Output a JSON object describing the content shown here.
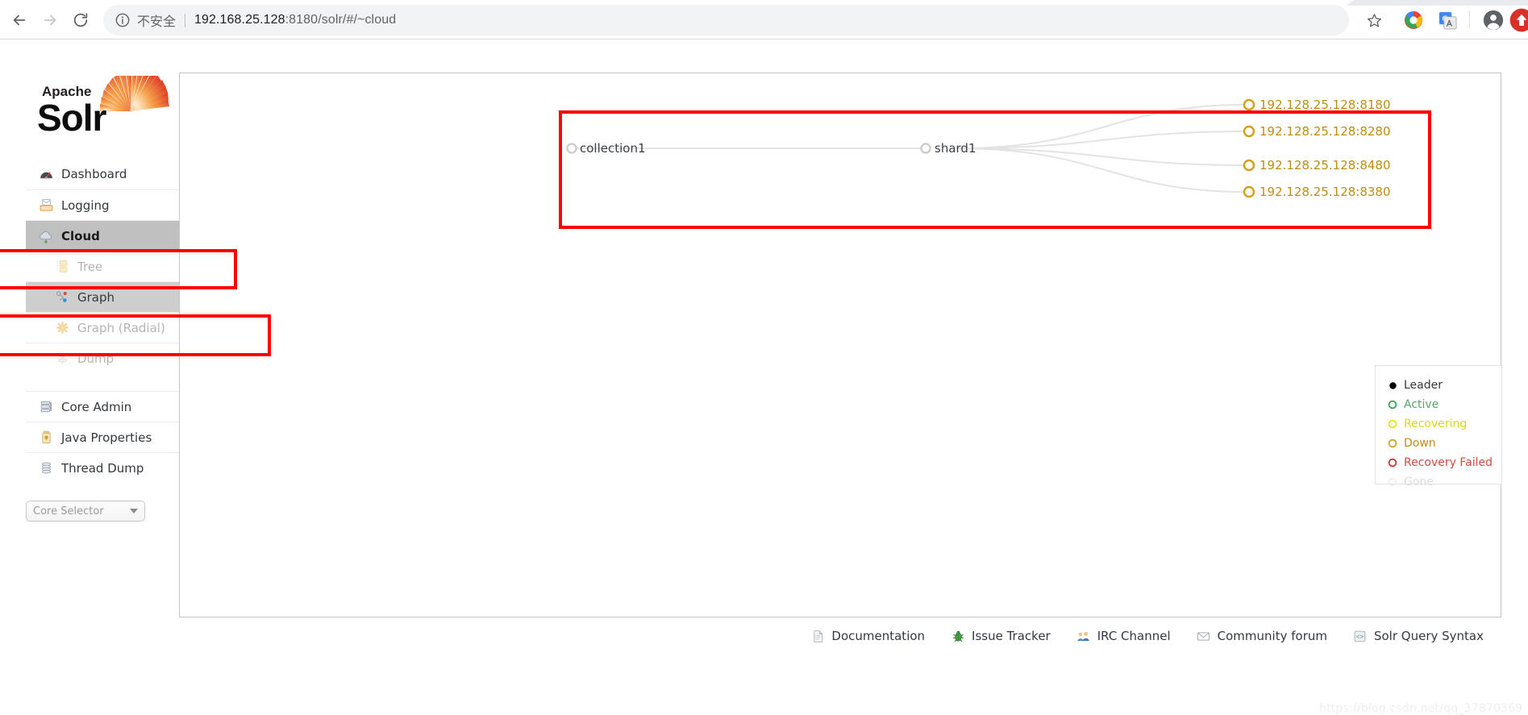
{
  "browser": {
    "back_icon": "arrow-left-icon",
    "forward_icon": "arrow-right-icon",
    "reload_icon": "reload-icon",
    "info_icon": "info-circle-icon",
    "security_label": "不安全",
    "url_prefix": "192.168.25.128",
    "url_port": ":8180",
    "url_path": "/solr/#/~cloud",
    "url_full": "192.168.25.128:8180/solr/#/~cloud",
    "star_icon": "bookmark-star-icon",
    "chrome_ring_icon": "chrome-extension-icon",
    "translate_icon": "google-translate-icon",
    "profile_icon": "profile-avatar-icon",
    "update_icon": "update-available-icon"
  },
  "sidebar": {
    "logo_alt": "Apache Solr",
    "logo_word_top": "Apache",
    "logo_word_main": "Solr",
    "items": [
      {
        "label": "Dashboard",
        "icon": "dashboard-gauge-icon",
        "state": "normal",
        "sub": false
      },
      {
        "label": "Logging",
        "icon": "logging-tray-icon",
        "state": "normal",
        "sub": false
      },
      {
        "label": "Cloud",
        "icon": "cloud-icon",
        "state": "active",
        "sub": false
      },
      {
        "label": "Tree",
        "icon": "tree-folder-icon",
        "state": "disabled",
        "sub": true
      },
      {
        "label": "Graph",
        "icon": "graph-nodes-icon",
        "state": "sub-active",
        "sub": true
      },
      {
        "label": "Graph (Radial)",
        "icon": "radial-star-icon",
        "state": "disabled",
        "sub": true
      },
      {
        "label": "Dump",
        "icon": "dump-icon",
        "state": "disabled",
        "sub": true
      },
      {
        "label": "Core Admin",
        "icon": "core-admin-icon",
        "state": "normal",
        "sub": false
      },
      {
        "label": "Java Properties",
        "icon": "java-properties-icon",
        "state": "normal",
        "sub": false
      },
      {
        "label": "Thread Dump",
        "icon": "thread-dump-icon",
        "state": "normal",
        "sub": false
      }
    ],
    "core_selector": {
      "label": "Core Selector",
      "arrow_icon": "chevron-down-icon"
    }
  },
  "graph": {
    "collection": {
      "label": "collection1",
      "status": "gone",
      "color": "#cccccc"
    },
    "shard": {
      "label": "shard1",
      "status": "gone",
      "color": "#cccccc"
    },
    "replicas": [
      {
        "label": "192.128.25.128:8180",
        "status": "down",
        "color": "#d4a017"
      },
      {
        "label": "192.128.25.128:8280",
        "status": "down",
        "color": "#d4a017"
      },
      {
        "label": "192.128.25.128:8480",
        "status": "down",
        "color": "#d4a017"
      },
      {
        "label": "192.128.25.128:8380",
        "status": "down",
        "color": "#d4a017"
      }
    ],
    "legend": [
      {
        "label": "Leader",
        "color": "#000000",
        "filled": true,
        "text_color": "#33383d"
      },
      {
        "label": "Active",
        "color": "#31a354",
        "filled": false,
        "text_color": "#5ba36d"
      },
      {
        "label": "Recovering",
        "color": "#e9e60b",
        "filled": false,
        "text_color": "#dcd81a"
      },
      {
        "label": "Down",
        "color": "#d4a017",
        "filled": false,
        "text_color": "#c08d13"
      },
      {
        "label": "Recovery Failed",
        "color": "#d62728",
        "filled": false,
        "text_color": "#cf4b45"
      },
      {
        "label": "Gone",
        "color": "#eeeeee",
        "filled": false,
        "text_color": "#dcdcdc"
      }
    ]
  },
  "footer": {
    "links": [
      {
        "label": "Documentation",
        "icon": "document-page-icon"
      },
      {
        "label": "Issue Tracker",
        "icon": "bug-icon"
      },
      {
        "label": "IRC Channel",
        "icon": "people-group-icon"
      },
      {
        "label": "Community forum",
        "icon": "envelope-icon"
      },
      {
        "label": "Solr Query Syntax",
        "icon": "code-block-icon"
      }
    ]
  },
  "watermark": {
    "text": "https://blog.csdn.net/qq_37870369"
  },
  "annotations": {
    "accent_color": "#fe0000",
    "boxes": [
      "graph-area",
      "cloud-nav-item",
      "graph-nav-item"
    ]
  }
}
